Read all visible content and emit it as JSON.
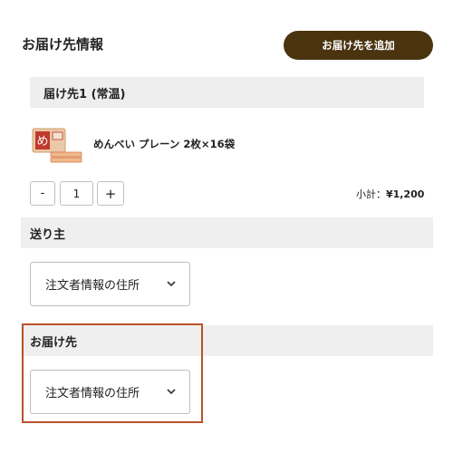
{
  "header": {
    "title": "お届け先情報",
    "add_button": "お届け先を追加"
  },
  "destination": {
    "label": "届け先1 (常温)",
    "product_name": "めんべい プレーン 2枚×16袋",
    "quantity": "1",
    "minus_label": "-",
    "plus_label": "+",
    "subtotal_label": "小計：",
    "subtotal_value": "¥1,200"
  },
  "sender": {
    "label": "送り主",
    "select_value": "注文者情報の住所"
  },
  "recipient": {
    "label": "お届け先",
    "select_value": "注文者情報の住所"
  },
  "colors": {
    "accent_button": "#4a3410",
    "highlight_border": "#b8522a",
    "section_bg": "#efefef"
  }
}
